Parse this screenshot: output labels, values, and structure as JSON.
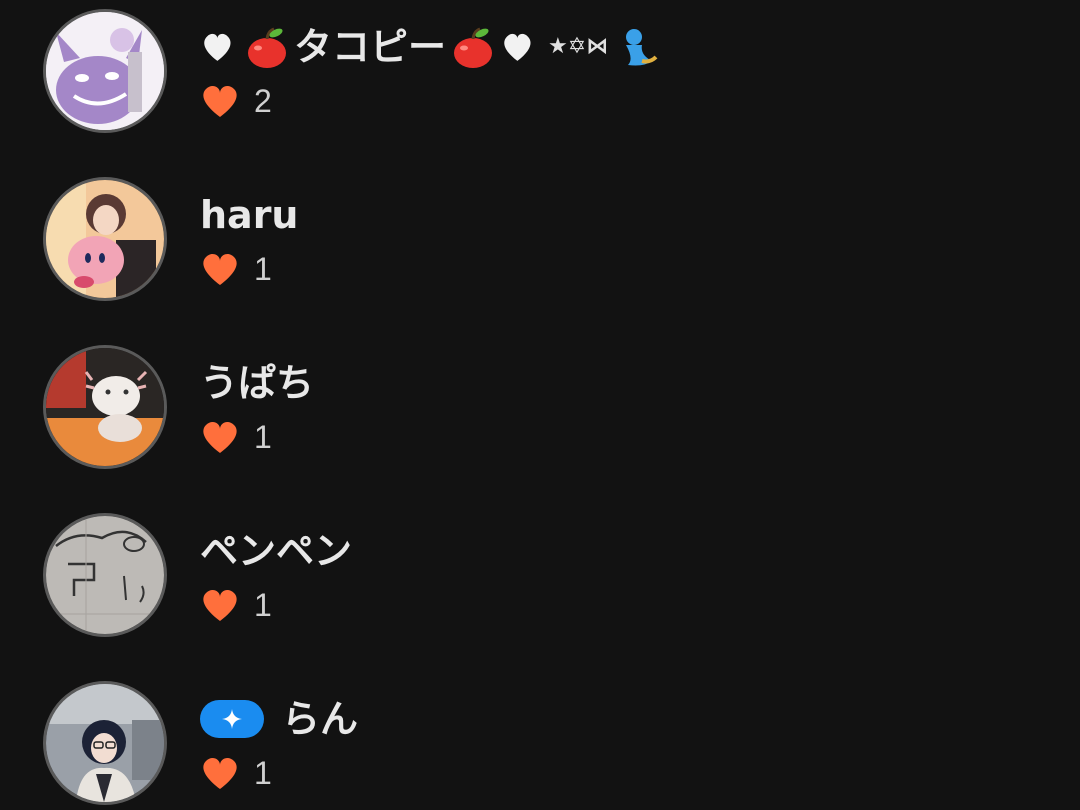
{
  "rows": [
    {
      "name_prefix_icons": [
        "white-heart-icon",
        "apple-icon"
      ],
      "name_text": "タコピー",
      "name_suffix_icons": [
        "apple-icon",
        "white-heart-icon"
      ],
      "name_symbols": "★✡⋈",
      "trailing_icon": "genie-icon",
      "likes": "2"
    },
    {
      "name_text": "haru",
      "likes": "1"
    },
    {
      "name_text": "うぱち",
      "likes": "1"
    },
    {
      "name_text": "ペンペン",
      "likes": "1"
    },
    {
      "badge_icon": "sparkle-icon",
      "name_text": "らん",
      "likes": "1"
    }
  ],
  "colors": {
    "background": "#121212",
    "heart": "#ff6f3c",
    "badge": "#1a8cf0",
    "text": "#e8e8e8"
  }
}
